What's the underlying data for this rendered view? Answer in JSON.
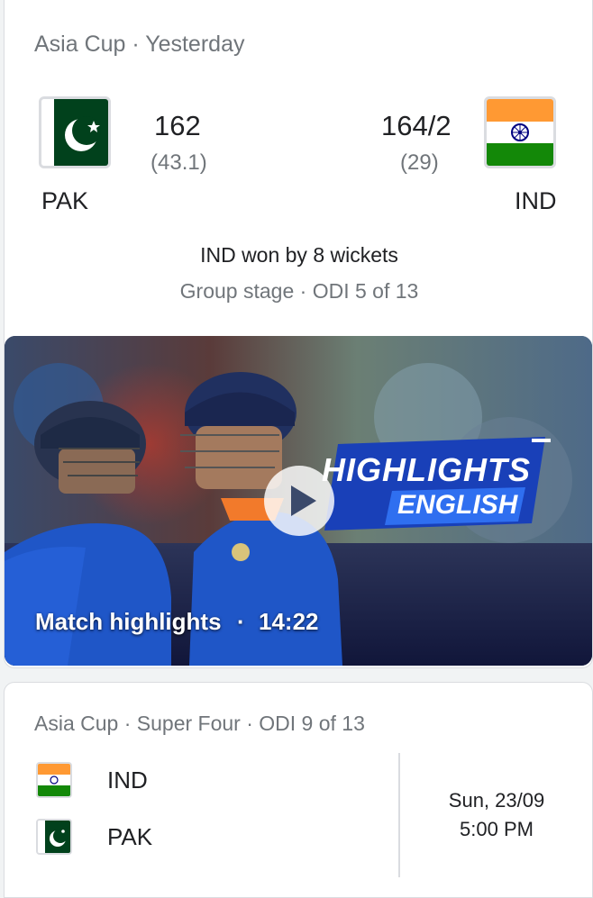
{
  "match1": {
    "header": "Asia Cup · Yesterday",
    "team1": {
      "abbr": "PAK",
      "score": "162",
      "overs": "(43.1)"
    },
    "team2": {
      "abbr": "IND",
      "score": "164/2",
      "overs": "(29)"
    },
    "result": "IND won by 8 wickets",
    "stage": "Group stage · ODI 5 of 13",
    "video": {
      "title": "Match highlights",
      "separator": "·",
      "duration": "14:22",
      "badge_line1": "HIGHLIGHTS",
      "badge_line2": "ENGLISH"
    }
  },
  "match2": {
    "header": "Asia Cup · Super Four · ODI 9 of 13",
    "team1": "IND",
    "team2": "PAK",
    "date": "Sun, 23/09",
    "time": "5:00 PM"
  },
  "colors": {
    "pak_green": "#01411c",
    "ind_saffron": "#ff9933",
    "ind_green": "#138808",
    "chakra": "#000080"
  }
}
